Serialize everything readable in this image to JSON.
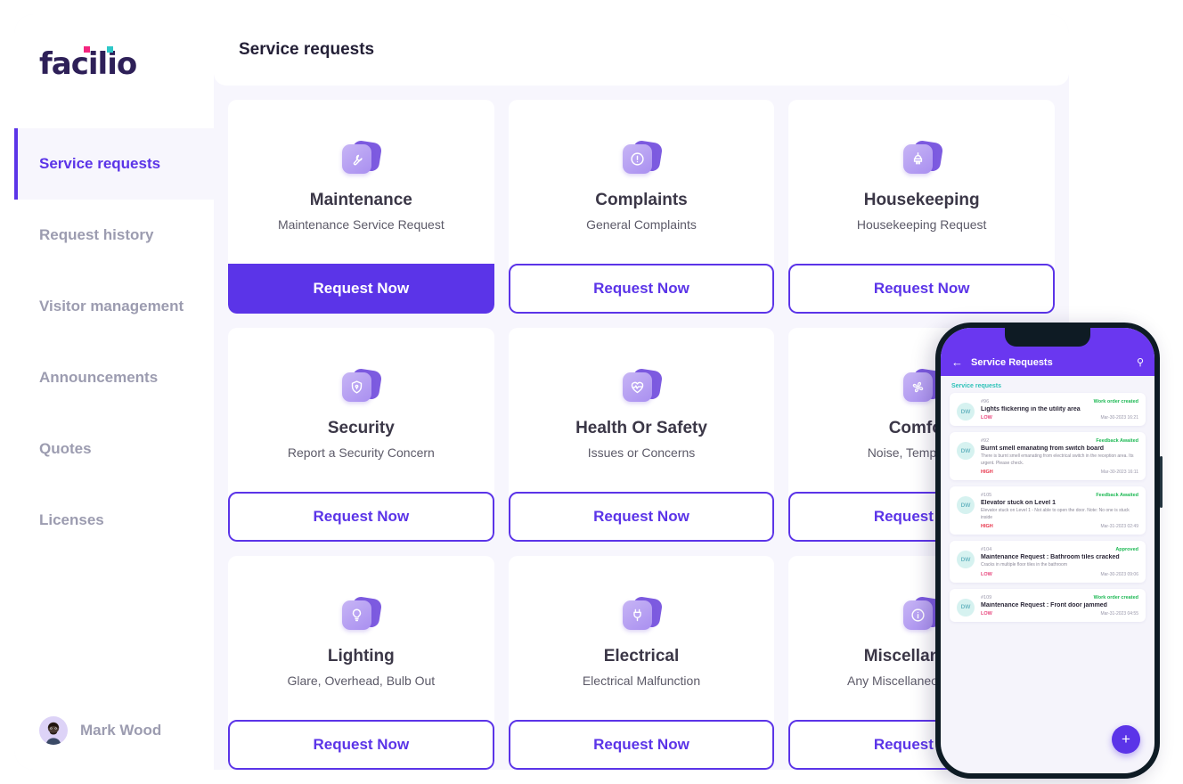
{
  "brand": {
    "name": "facilio"
  },
  "sidebar": {
    "items": [
      {
        "label": "Service requests",
        "active": true
      },
      {
        "label": "Request history",
        "active": false
      },
      {
        "label": "Visitor management",
        "active": false
      },
      {
        "label": "Announcements",
        "active": false
      },
      {
        "label": "Quotes",
        "active": false
      },
      {
        "label": "Licenses",
        "active": false
      }
    ],
    "profile": {
      "name": "Mark Wood",
      "avatar_icon": "user-avatar"
    }
  },
  "header": {
    "title": "Service requests"
  },
  "colors": {
    "accent": "#5b34e8",
    "phone_header": "#6a37f0",
    "teal": "#2ec2b8",
    "status_green": "#1db954",
    "priority_low": "#e8457c",
    "priority_high": "#e8344a"
  },
  "cards": [
    {
      "title": "Maintenance",
      "subtitle": "Maintenance Service Request",
      "icon": "wrench-icon",
      "button": "Request Now",
      "primary": true
    },
    {
      "title": "Complaints",
      "subtitle": "General Complaints",
      "icon": "alert-circle-icon",
      "button": "Request Now",
      "primary": false
    },
    {
      "title": "Housekeeping",
      "subtitle": "Housekeeping Request",
      "icon": "brush-icon",
      "button": "Request Now",
      "primary": false
    },
    {
      "title": "Security",
      "subtitle": "Report a Security Concern",
      "icon": "shield-lock-icon",
      "button": "Request Now",
      "primary": false
    },
    {
      "title": "Health Or Safety",
      "subtitle": "Issues or Concerns",
      "icon": "heart-pulse-icon",
      "button": "Request Now",
      "primary": false
    },
    {
      "title": "Comfort",
      "subtitle": "Noise, Temperature",
      "icon": "fan-icon",
      "button": "Request Now",
      "primary": false
    },
    {
      "title": "Lighting",
      "subtitle": "Glare, Overhead, Bulb Out",
      "icon": "bulb-icon",
      "button": "Request Now",
      "primary": false
    },
    {
      "title": "Electrical",
      "subtitle": "Electrical Malfunction",
      "icon": "plug-icon",
      "button": "Request Now",
      "primary": false
    },
    {
      "title": "Miscellaneous",
      "subtitle": "Any Miscellaneous Service",
      "icon": "info-icon",
      "button": "Request Now",
      "primary": false
    }
  ],
  "phone": {
    "back_icon": "arrow-left-icon",
    "title": "Service Requests",
    "search_icon": "search-icon",
    "section_label": "Service requests",
    "fab_icon": "plus-icon",
    "requests": [
      {
        "avatar": "DW",
        "id": "#96",
        "status": "Work order created",
        "subject": "Lights flickering in the utility area",
        "description": "",
        "priority": "LOW",
        "time": "Mar-30-2023 16:21"
      },
      {
        "avatar": "DW",
        "id": "#92",
        "status": "Feedback Awaited",
        "subject": "Burnt smell emanating from switch board",
        "description": "There is burnt smell emanating from electrical switch in the reception area. Its urgent. Please check.",
        "priority": "HIGH",
        "time": "Mar-30-2023 16:11"
      },
      {
        "avatar": "DW",
        "id": "#105",
        "status": "Feedback Awaited",
        "subject": "Elevator stuck on Level 1",
        "description": "Elevator stuck on Level 1 - Not able to open the door. Note: No one is stuck inside",
        "priority": "HIGH",
        "time": "Mar-31-2023 02:49"
      },
      {
        "avatar": "DW",
        "id": "#104",
        "status": "Approved",
        "subject": "Maintenance Request : Bathroom tiles cracked",
        "description": "Cracks in multiple floor tiles in the bathroom",
        "priority": "LOW",
        "time": "Mar-30-2023 09:06"
      },
      {
        "avatar": "DW",
        "id": "#109",
        "status": "Work order created",
        "subject": "Maintenance Request : Front door jammed",
        "description": "",
        "priority": "LOW",
        "time": "Mar-31-2023 04:55"
      }
    ]
  }
}
